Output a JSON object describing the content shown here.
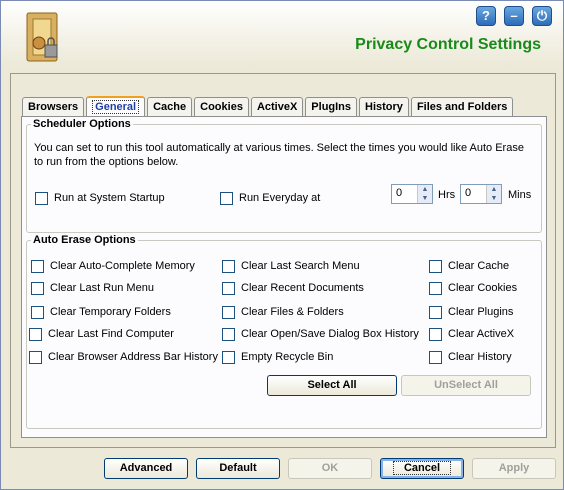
{
  "header": {
    "title": "Privacy Control Settings",
    "help_label": "?",
    "minimize_label": "–",
    "power_label": "⏻"
  },
  "tabs": [
    {
      "label": "Browsers"
    },
    {
      "label": "General"
    },
    {
      "label": "Cache"
    },
    {
      "label": "Cookies"
    },
    {
      "label": "ActiveX"
    },
    {
      "label": "PlugIns"
    },
    {
      "label": "History"
    },
    {
      "label": "Files and Folders"
    }
  ],
  "active_tab": "General",
  "scheduler": {
    "legend": "Scheduler Options",
    "description": "You can set to run this tool automatically at various times. Select the times you would like Auto Erase to run from the options below.",
    "startup_label": "Run at System Startup",
    "everyday_label": "Run Everyday at",
    "hrs_value": "0",
    "hrs_label": "Hrs",
    "mins_value": "0",
    "mins_label": "Mins"
  },
  "auto_erase": {
    "legend": "Auto Erase Options",
    "col1": [
      "Clear Auto-Complete Memory",
      "Clear Last Run Menu",
      "Clear Temporary Folders",
      "Clear Last Find Computer",
      "Clear Browser Address Bar History"
    ],
    "col2": [
      "Clear Last Search Menu",
      "Clear Recent Documents",
      "Clear Files & Folders",
      "Clear Open/Save Dialog Box History",
      "Empty Recycle Bin"
    ],
    "col3": [
      "Clear Cache",
      "Clear Cookies",
      "Clear Plugins",
      "Clear ActiveX",
      "Clear History"
    ],
    "select_all_label": "Select All",
    "unselect_all_label": "UnSelect All"
  },
  "footer": {
    "advanced_label": "Advanced",
    "default_label": "Default",
    "ok_label": "OK",
    "cancel_label": "Cancel",
    "apply_label": "Apply"
  }
}
